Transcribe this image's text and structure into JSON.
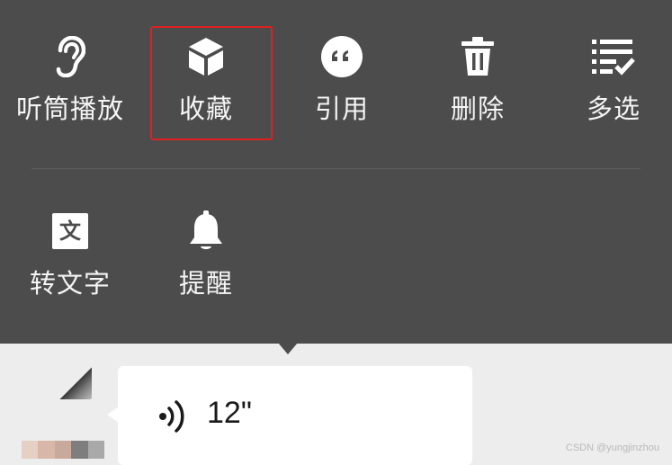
{
  "menu": {
    "items": [
      {
        "label": "听筒播放",
        "icon": "ear-icon"
      },
      {
        "label": "收藏",
        "icon": "cube-icon"
      },
      {
        "label": "引用",
        "icon": "quote-icon"
      },
      {
        "label": "删除",
        "icon": "trash-icon"
      },
      {
        "label": "多选",
        "icon": "multi-select-icon"
      },
      {
        "label": "转文字",
        "icon": "text-icon"
      },
      {
        "label": "提醒",
        "icon": "bell-icon"
      }
    ],
    "text_icon_glyph": "文",
    "background": "#4c4c4c",
    "highlight_color": "#e02020"
  },
  "message": {
    "duration": "12\"",
    "icon": "voice-icon"
  },
  "watermark": "CSDN @yungjinzhou"
}
